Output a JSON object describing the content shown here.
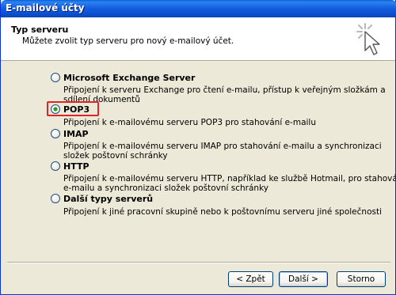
{
  "window": {
    "title": "E-mailové účty"
  },
  "header": {
    "title": "Typ serveru",
    "subtitle": "Můžete zvolit typ serveru pro nový e-mailový účet.",
    "icon": "wizard-cursor-icon"
  },
  "options": [
    {
      "label": "Microsoft Exchange Server",
      "desc": [
        "Připojení k serveru Exchange pro čtení e-mailu, přístup k veřejným složkám a",
        "sdílení dokumentů"
      ],
      "checked": false
    },
    {
      "label": "POP3",
      "desc": [
        "Připojení k e-mailovému serveru POP3 pro stahování e-mailu"
      ],
      "checked": true
    },
    {
      "label": "IMAP",
      "desc": [
        "Připojení k e-mailovému serveru IMAP pro stahování e-mailu a synchronizaci",
        "složek poštovní schránky"
      ],
      "checked": false
    },
    {
      "label": "HTTP",
      "desc": [
        "Připojení k e-mailovému serveru HTTP, například ke službě Hotmail, pro stahování",
        "e-mailu a synchronizaci složek poštovní schránky"
      ],
      "checked": false
    },
    {
      "label": "Další typy serverů",
      "desc": [
        "Připojení k jiné pracovní skupině nebo k poštovnímu serveru jiné společnosti"
      ],
      "checked": false
    }
  ],
  "buttons": {
    "back": "< Zpět",
    "next": "Další >",
    "cancel": "Storno"
  },
  "colors": {
    "highlight": "#e2242a",
    "titlebar": "#0a4fd0"
  }
}
